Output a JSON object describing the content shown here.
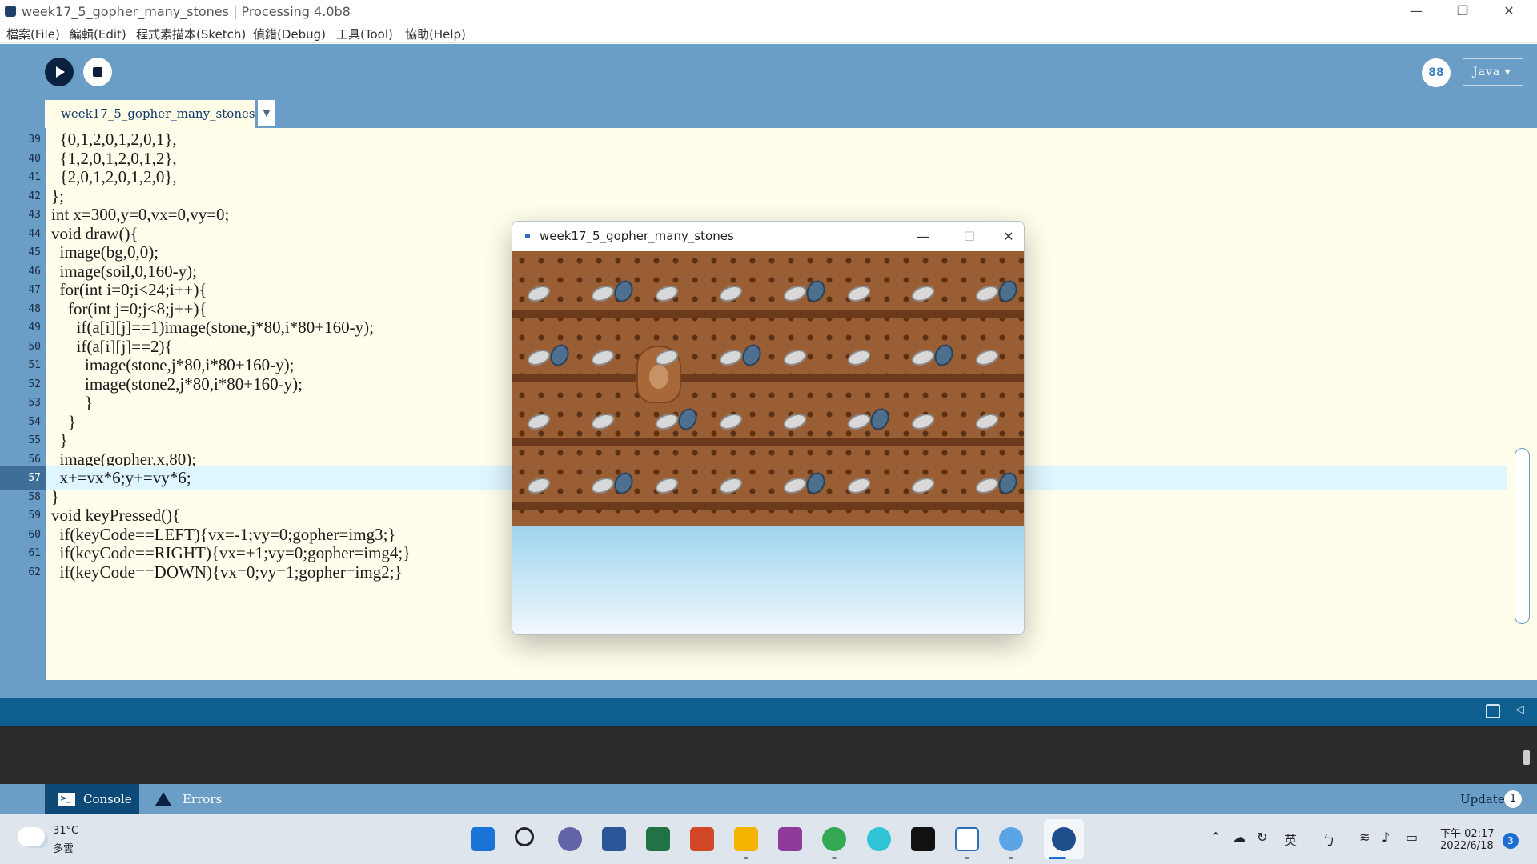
{
  "window": {
    "title": "week17_5_gopher_many_stones | Processing 4.0b8",
    "min_glyph": "—",
    "max_glyph": "❐",
    "close_glyph": "✕"
  },
  "menu": [
    "檔案(File)",
    "編輯(Edit)",
    "程式素描本(Sketch)",
    "偵錯(Debug)",
    "工具(Tool)",
    "協助(Help)"
  ],
  "toolbar": {
    "mode_icon_text": "88",
    "mode_label": "Java ▾"
  },
  "tab": {
    "label": "week17_5_gopher_many_stones",
    "menu_glyph": "▼"
  },
  "editor": {
    "current_line": 57,
    "lines": [
      {
        "num": "39",
        "code": "  {0,1,2,0,1,2,0,1},"
      },
      {
        "num": "40",
        "code": "  {1,2,0,1,2,0,1,2},"
      },
      {
        "num": "41",
        "code": "  {2,0,1,2,0,1,2,0},"
      },
      {
        "num": "42",
        "code": "};"
      },
      {
        "num": "43",
        "code": "int x=300,y=0,vx=0,vy=0;"
      },
      {
        "num": "44",
        "code": "void draw(){"
      },
      {
        "num": "45",
        "code": "  image(bg,0,0);"
      },
      {
        "num": "46",
        "code": "  image(soil,0,160-y);"
      },
      {
        "num": "47",
        "code": "  for(int i=0;i<24;i++){"
      },
      {
        "num": "48",
        "code": "    for(int j=0;j<8;j++){"
      },
      {
        "num": "49",
        "code": "      if(a[i][j]==1)image(stone,j*80,i*80+160-y);"
      },
      {
        "num": "50",
        "code": "      if(a[i][j]==2){"
      },
      {
        "num": "51",
        "code": "        image(stone,j*80,i*80+160-y);"
      },
      {
        "num": "52",
        "code": "        image(stone2,j*80,i*80+160-y);"
      },
      {
        "num": "53",
        "code": "        }"
      },
      {
        "num": "54",
        "code": "    }"
      },
      {
        "num": "55",
        "code": "  }"
      },
      {
        "num": "56",
        "code": "  image(gopher,x,80);"
      },
      {
        "num": "57",
        "code": "  x+=vx*6;y+=vy*6;"
      },
      {
        "num": "58",
        "code": "}"
      },
      {
        "num": "59",
        "code": "void keyPressed(){"
      },
      {
        "num": "60",
        "code": "  if(keyCode==LEFT){vx=-1;vy=0;gopher=img3;}"
      },
      {
        "num": "61",
        "code": "  if(keyCode==RIGHT){vx=+1;vy=0;gopher=img4;}"
      },
      {
        "num": "62",
        "code": "  if(keyCode==DOWN){vx=0;vy=1;gopher=img2;}"
      }
    ]
  },
  "sketch_window": {
    "title": "week17_5_gopher_many_stones",
    "min_glyph": "—",
    "max_glyph": "☐",
    "close_glyph": "✕"
  },
  "console": {
    "console_tab": "Console",
    "errors_tab": "Errors",
    "updates_label": "Updates",
    "updates_count": "1",
    "status_arrow": "◁"
  },
  "taskbar": {
    "weather_temp": "31°C",
    "weather_desc": "多雲",
    "ime_label": "英",
    "time": "下午 02:17",
    "date": "2022/6/18",
    "notification_count": "3",
    "apps": [
      "windows-start-icon",
      "search-icon",
      "teams-chat-icon",
      "word-icon",
      "excel-icon",
      "powerpoint-icon",
      "file-explorer-icon",
      "winrar-icon",
      "chrome-icon",
      "kmplayer-icon",
      "netflix-icon",
      "vscode-icon",
      "paint-icon",
      "processing-icon"
    ]
  },
  "colors": {
    "toolbar_bg": "#6b9ec7",
    "editor_bg": "#fffdeb",
    "current_line_bg": "#def6ff",
    "run_button": "#0c213f",
    "status_bar": "#0e5f8f"
  }
}
